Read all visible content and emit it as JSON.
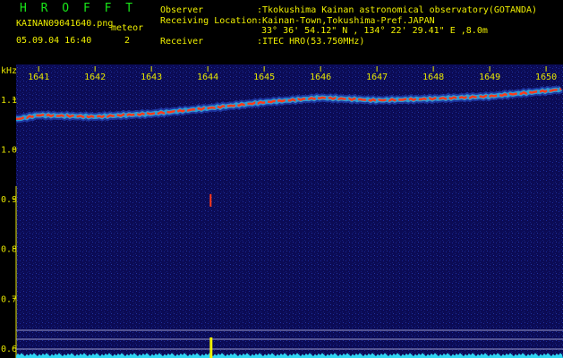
{
  "header": {
    "app_title": "H R O F F T",
    "file_name": "KAINAN09041640.png",
    "meteor_label": "meteor",
    "date_time": "05.09.04 16:40",
    "meteor_count": "2",
    "observer_label": "Observer",
    "observer_value": ":Tkokushima Kainan astronomical observatory(GOTANDA)",
    "location_label": "Receiving Location",
    "location_value": ":Kainan-Town,Tokushima-Pref.JAPAN",
    "coordinates": "33° 36' 54.12\" N , 134° 22' 29.41\" E ,8.0m",
    "receiver_label": "Receiver",
    "receiver_value": ":ITEC HRO(53.750MHz)"
  },
  "colors": {
    "title_green": "#19e619",
    "info_yellow": "#f0f000",
    "axis_yellow": "#e6e600",
    "background_blue": "#0b0b55",
    "echo_red": "#ff3a1a",
    "noise_cyan": "#2fd6f2"
  },
  "chart_data": {
    "type": "heatmap",
    "ylabel": "kHz",
    "x_tick_labels": [
      "1641",
      "1642",
      "1643",
      "1644",
      "1645",
      "1646",
      "1647",
      "1648",
      "1649",
      "1650"
    ],
    "y_tick_labels": [
      "1.1",
      "1.0",
      "0.9",
      "0.8",
      "0.7",
      "0.6"
    ],
    "y_tick_values": [
      1.1,
      1.0,
      0.9,
      0.8,
      0.7,
      0.6
    ],
    "ylim": [
      0.58,
      1.17
    ],
    "xlim": [
      1640.6,
      1650.3
    ],
    "carrier_frequency": {
      "x": [
        1640.6,
        1641.0,
        1642.0,
        1643.0,
        1644.0,
        1645.0,
        1646.0,
        1647.0,
        1648.0,
        1649.0,
        1650.3
      ],
      "y": [
        1.06,
        1.068,
        1.065,
        1.071,
        1.082,
        1.094,
        1.103,
        1.098,
        1.101,
        1.106,
        1.12
      ]
    },
    "meteor_echoes": [
      {
        "x": 1644.05,
        "y": 0.895
      }
    ],
    "grid": false
  }
}
